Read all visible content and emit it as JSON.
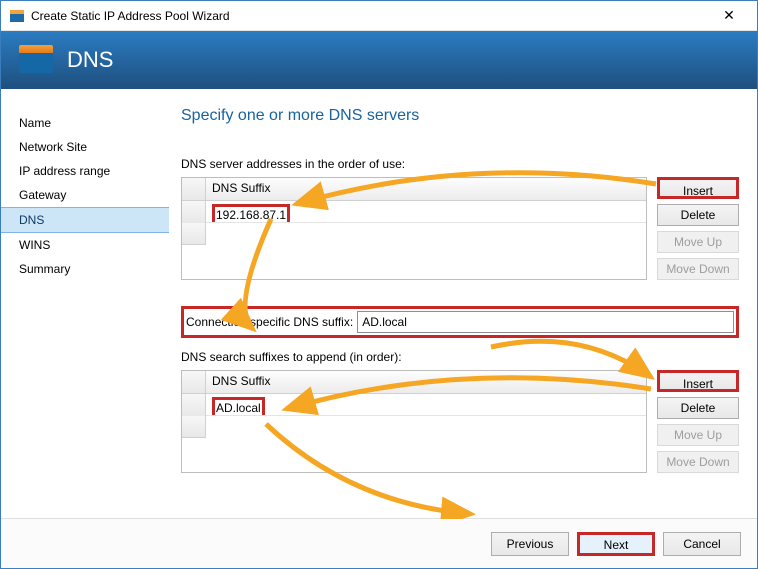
{
  "titlebar": {
    "title": "Create Static IP Address Pool Wizard"
  },
  "banner": {
    "heading": "DNS"
  },
  "sidebar": {
    "items": [
      {
        "label": "Name"
      },
      {
        "label": "Network Site"
      },
      {
        "label": "IP address range"
      },
      {
        "label": "Gateway"
      },
      {
        "label": "DNS"
      },
      {
        "label": "WINS"
      },
      {
        "label": "Summary"
      }
    ]
  },
  "main": {
    "heading": "Specify one or more DNS servers",
    "section1_label": "DNS server addresses in the order of use:",
    "grid1": {
      "column": "DNS Suffix",
      "rows": [
        "192.168.87.1",
        ""
      ]
    },
    "buttons1": {
      "insert": "Insert",
      "delete": "Delete",
      "moveup": "Move Up",
      "movedown": "Move Down"
    },
    "suffix_label": "Connection specific DNS suffix:",
    "suffix_value": "AD.local",
    "section2_label": "DNS search suffixes to append (in order):",
    "grid2": {
      "column": "DNS Suffix",
      "rows": [
        "AD.local",
        ""
      ]
    },
    "buttons2": {
      "insert": "Insert",
      "delete": "Delete",
      "moveup": "Move Up",
      "movedown": "Move Down"
    }
  },
  "footer": {
    "previous": "Previous",
    "next": "Next",
    "cancel": "Cancel"
  }
}
